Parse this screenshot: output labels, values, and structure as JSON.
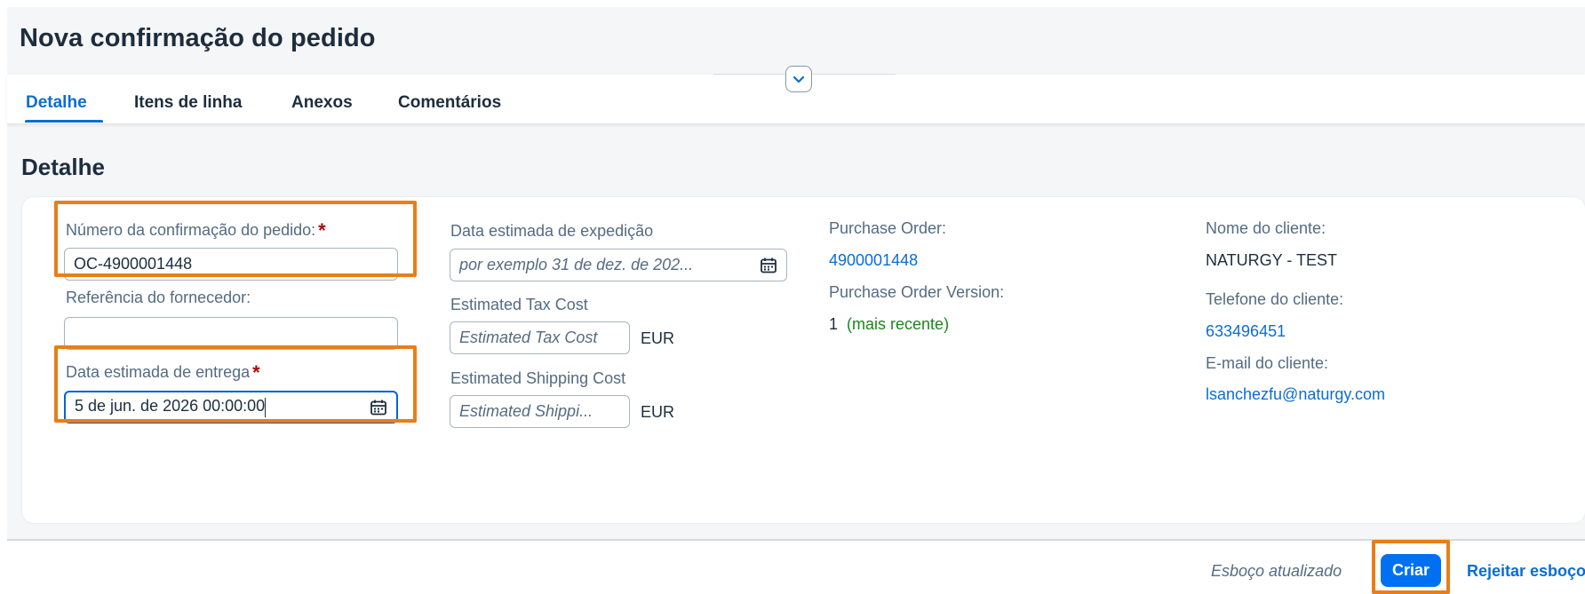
{
  "header": {
    "title": "Nova confirmação do pedido"
  },
  "tabs": [
    {
      "label": "Detalhe",
      "active": true
    },
    {
      "label": "Itens de linha",
      "active": false
    },
    {
      "label": "Anexos",
      "active": false
    },
    {
      "label": "Comentários",
      "active": false
    }
  ],
  "section": {
    "title": "Detalhe"
  },
  "form": {
    "confirmation_number": {
      "label": "Número da confirmação do pedido:",
      "required": "*",
      "value": "OC-4900001448"
    },
    "supplier_reference": {
      "label": "Referência do fornecedor:",
      "value": ""
    },
    "delivery_date": {
      "label": "Data estimada de entrega",
      "required": "*",
      "value": "5 de jun. de 2026 00:00:00"
    },
    "shipping_date": {
      "label": "Data estimada de expedição",
      "placeholder": "por exemplo 31 de dez. de 202..."
    },
    "tax_cost": {
      "label": "Estimated Tax Cost",
      "placeholder": "Estimated Tax Cost",
      "currency": "EUR"
    },
    "shipping_cost": {
      "label": "Estimated Shipping Cost",
      "placeholder": "Estimated Shippi...",
      "currency": "EUR"
    }
  },
  "info": {
    "purchase_order": {
      "label": "Purchase Order:",
      "value": "4900001448"
    },
    "purchase_order_version": {
      "label": "Purchase Order Version:",
      "value": "1",
      "note": "(mais recente)"
    },
    "customer_name": {
      "label": "Nome do cliente:",
      "value": "NATURGY - TEST"
    },
    "customer_phone": {
      "label": "Telefone do cliente:",
      "value": "633496451"
    },
    "customer_email": {
      "label": "E-mail do cliente:",
      "value": "lsanchezfu@naturgy.com"
    }
  },
  "footer": {
    "status": "Esboço atualizado",
    "create_label": "Criar",
    "reject_label": "Rejeitar esboço"
  },
  "colors": {
    "accent": "#0a6ed1",
    "primary_button": "#0070f2",
    "highlight": "#e87e1a",
    "required": "#aa0808",
    "positive": "#188918"
  },
  "icons": {
    "collapse": "chevron-down-icon",
    "date_picker": "calendar-icon"
  }
}
